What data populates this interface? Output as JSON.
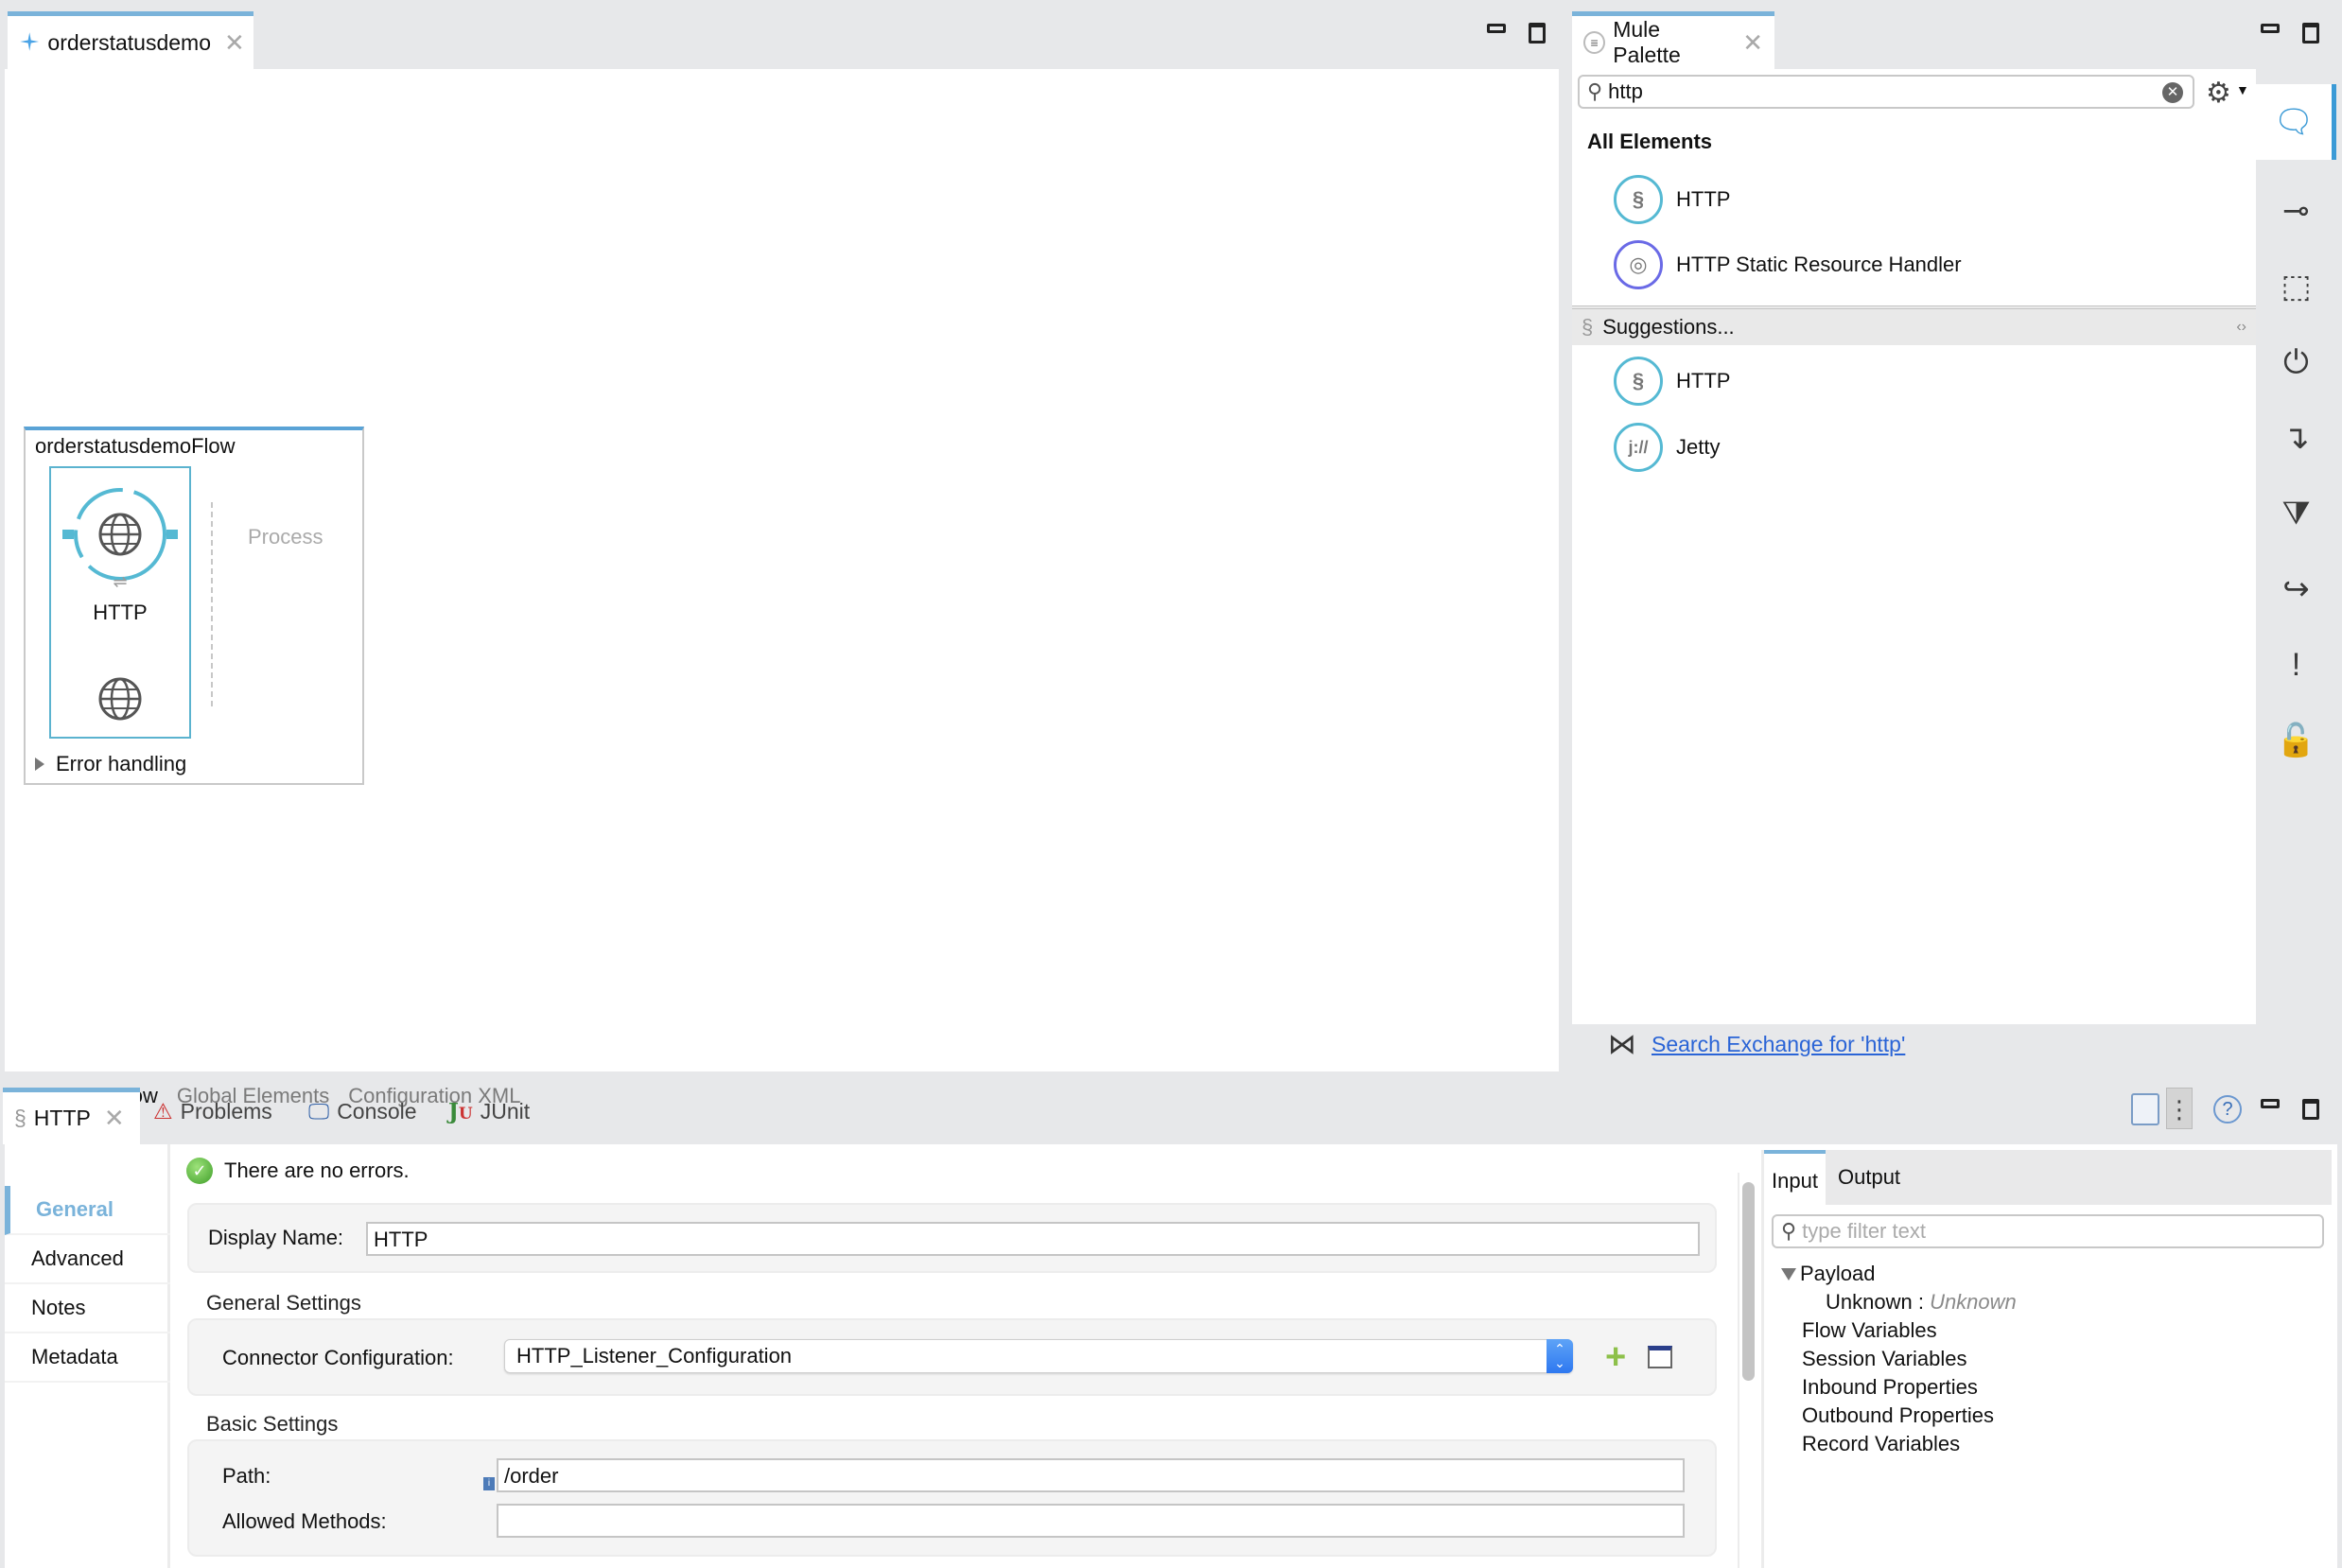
{
  "editor": {
    "tab_label": "orderstatusdemo",
    "flow": {
      "name": "orderstatusdemoFlow",
      "source_label": "HTTP",
      "process_label": "Process",
      "error_handling_label": "Error handling"
    },
    "bottom_tabs": [
      {
        "label": "Message Flow",
        "active": true
      },
      {
        "label": "Global Elements",
        "active": false
      },
      {
        "label": "Configuration XML",
        "active": false
      }
    ]
  },
  "palette": {
    "tab_label": "Mule Palette",
    "search_value": "http",
    "all_elements_title": "All Elements",
    "all_elements": [
      {
        "label": "HTTP",
        "icon": "http-connector-icon"
      },
      {
        "label": "HTTP Static Resource Handler",
        "icon": "static-resource-icon"
      }
    ],
    "suggestions_title": "Suggestions...",
    "suggestions": [
      {
        "label": "HTTP",
        "icon": "http-connector-icon"
      },
      {
        "label": "Jetty",
        "icon": "jetty-icon"
      }
    ],
    "exchange_link": "Search Exchange for 'http'",
    "side_icons": [
      "search-icon",
      "connector-icon",
      "scope-icon",
      "transformer-icon",
      "flow-control-icon",
      "filter-icon",
      "component-icon",
      "error-handling-icon",
      "security-icon"
    ]
  },
  "bottom_panel": {
    "tabs": [
      {
        "label": "HTTP",
        "active": true
      },
      {
        "label": "Problems",
        "active": false
      },
      {
        "label": "Console",
        "active": false
      },
      {
        "label": "JUnit",
        "active": false
      }
    ],
    "nav": [
      {
        "label": "General",
        "active": true
      },
      {
        "label": "Advanced",
        "active": false
      },
      {
        "label": "Notes",
        "active": false
      },
      {
        "label": "Metadata",
        "active": false
      }
    ],
    "status": "There are no errors.",
    "display_name_label": "Display Name:",
    "display_name_value": "HTTP",
    "general_settings_title": "General Settings",
    "connector_config_label": "Connector Configuration:",
    "connector_config_value": "HTTP_Listener_Configuration",
    "basic_settings_title": "Basic Settings",
    "path_label": "Path:",
    "path_value": "/order",
    "allowed_methods_label": "Allowed Methods:",
    "allowed_methods_value": "",
    "io": {
      "tabs": [
        {
          "label": "Input",
          "active": true
        },
        {
          "label": "Output",
          "active": false
        }
      ],
      "filter_placeholder": "type filter text",
      "payload_label": "Payload",
      "payload_child_key": "Unknown",
      "payload_child_sep": " : ",
      "payload_child_value": "Unknown",
      "items": [
        "Flow Variables",
        "Session Variables",
        "Inbound Properties",
        "Outbound Properties",
        "Record Variables"
      ]
    }
  }
}
